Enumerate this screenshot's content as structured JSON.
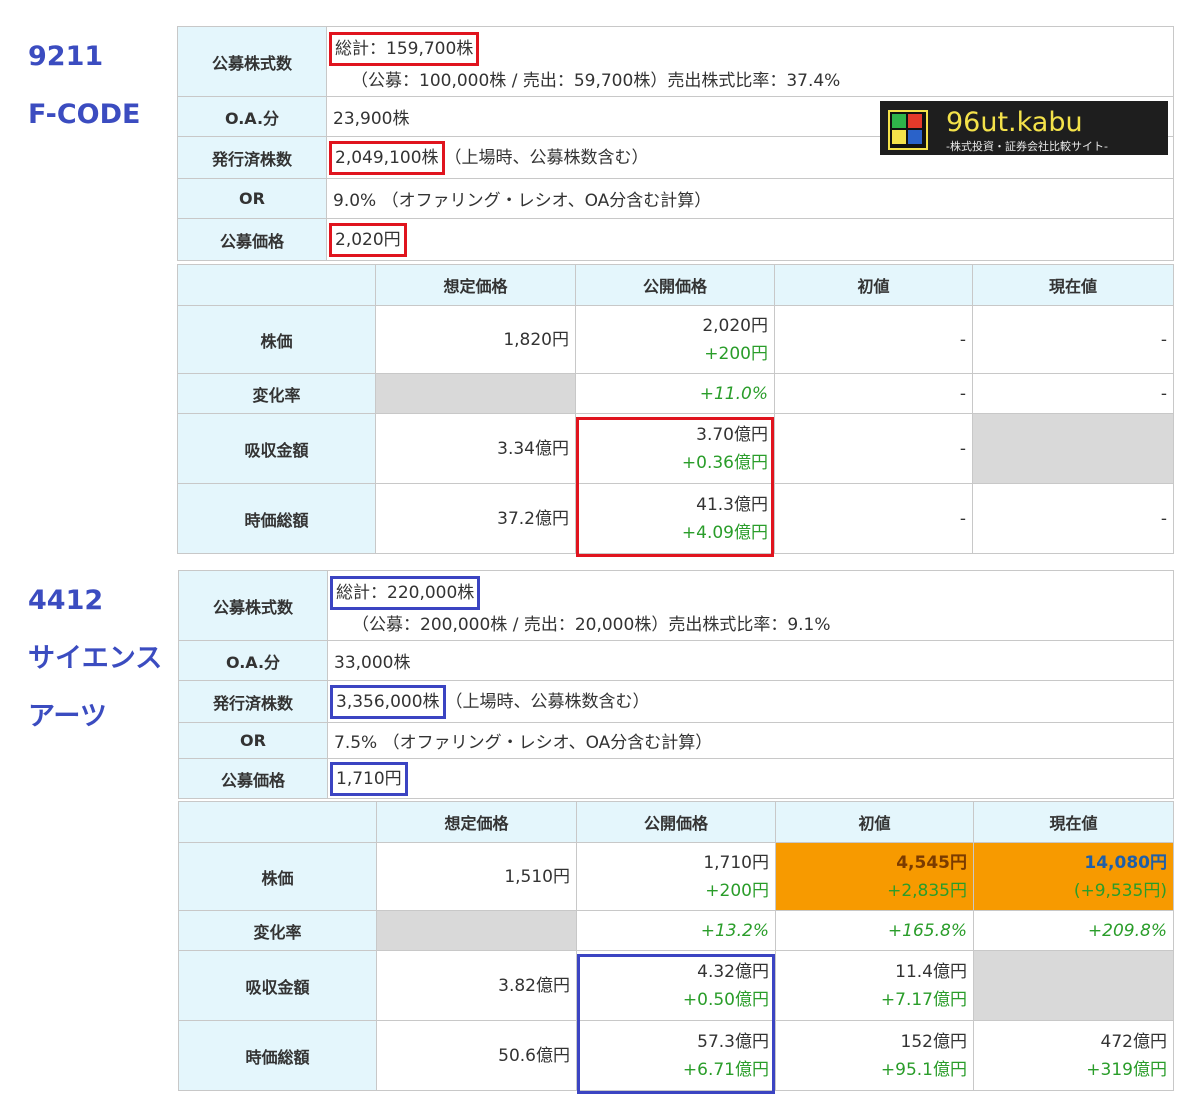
{
  "logo": {
    "name": "96ut.kabu",
    "tagline": "-株式投資・証券会社比較サイト-"
  },
  "ipo1": {
    "code": "9211",
    "name_lines": [
      "F-CODE"
    ],
    "info": [
      {
        "label": "公募株式数",
        "value": "総計：159,700株",
        "sub": "（公募：100,000株 / 売出：59,700株）売出株式比率：37.4%"
      },
      {
        "label": "O.A.分",
        "value": "23,900株"
      },
      {
        "label": "発行済株数",
        "value": "2,049,100株",
        "note": "（上場時、公募株数含む）"
      },
      {
        "label": "OR",
        "value": "9.0% （オファリング・レシオ、OA分含む計算）"
      },
      {
        "label": "公募価格",
        "value": "2,020円"
      }
    ],
    "headers": [
      "",
      "想定価格",
      "公開価格",
      "初値",
      "現在値"
    ],
    "rows": [
      {
        "label": "株価",
        "cells": [
          [
            "1,820円"
          ],
          [
            "2,020円",
            "+200円"
          ],
          [
            "-"
          ],
          [
            "-"
          ]
        ]
      },
      {
        "label": "変化率",
        "cells": [
          [
            ""
          ],
          [
            "+11.0%"
          ],
          [
            "-"
          ],
          [
            "-"
          ]
        ]
      },
      {
        "label": "吸収金額",
        "cells": [
          [
            "3.34億円"
          ],
          [
            "3.70億円",
            "+0.36億円"
          ],
          [
            "-"
          ],
          [
            ""
          ]
        ]
      },
      {
        "label": "時価総額",
        "cells": [
          [
            "37.2億円"
          ],
          [
            "41.3億円",
            "+4.09億円"
          ],
          [
            "-"
          ],
          [
            "-"
          ]
        ]
      }
    ]
  },
  "ipo2": {
    "code": "4412",
    "name_lines": [
      "サイエンス",
      "アーツ"
    ],
    "info": [
      {
        "label": "公募株式数",
        "value": "総計：220,000株",
        "sub": "（公募：200,000株 / 売出：20,000株）売出株式比率：9.1%"
      },
      {
        "label": "O.A.分",
        "value": "33,000株"
      },
      {
        "label": "発行済株数",
        "value": "3,356,000株",
        "note": "（上場時、公募株数含む）"
      },
      {
        "label": "OR",
        "value": "7.5% （オファリング・レシオ、OA分含む計算）"
      },
      {
        "label": "公募価格",
        "value": "1,710円"
      }
    ],
    "headers": [
      "",
      "想定価格",
      "公開価格",
      "初値",
      "現在値"
    ],
    "rows": [
      {
        "label": "株価",
        "cells": [
          [
            "1,510円"
          ],
          [
            "1,710円",
            "+200円"
          ],
          [
            "4,545円",
            "+2,835円"
          ],
          [
            "14,080円",
            "(+9,535円)"
          ]
        ]
      },
      {
        "label": "変化率",
        "cells": [
          [
            ""
          ],
          [
            "+13.2%"
          ],
          [
            "+165.8%"
          ],
          [
            "+209.8%"
          ]
        ]
      },
      {
        "label": "吸収金額",
        "cells": [
          [
            "3.82億円"
          ],
          [
            "4.32億円",
            "+0.50億円"
          ],
          [
            "11.4億円",
            "+7.17億円"
          ],
          [
            ""
          ]
        ]
      },
      {
        "label": "時価総額",
        "cells": [
          [
            "50.6億円"
          ],
          [
            "57.3億円",
            "+6.71億円"
          ],
          [
            "152億円",
            "+95.1億円"
          ],
          [
            "472億円",
            "+319億円"
          ]
        ]
      }
    ]
  },
  "colors": {
    "red": "#e0141e",
    "blue": "#3b44c2",
    "header_bg": "#e4f6fc",
    "orange": "#f79a00",
    "green": "#2a9d2a"
  }
}
